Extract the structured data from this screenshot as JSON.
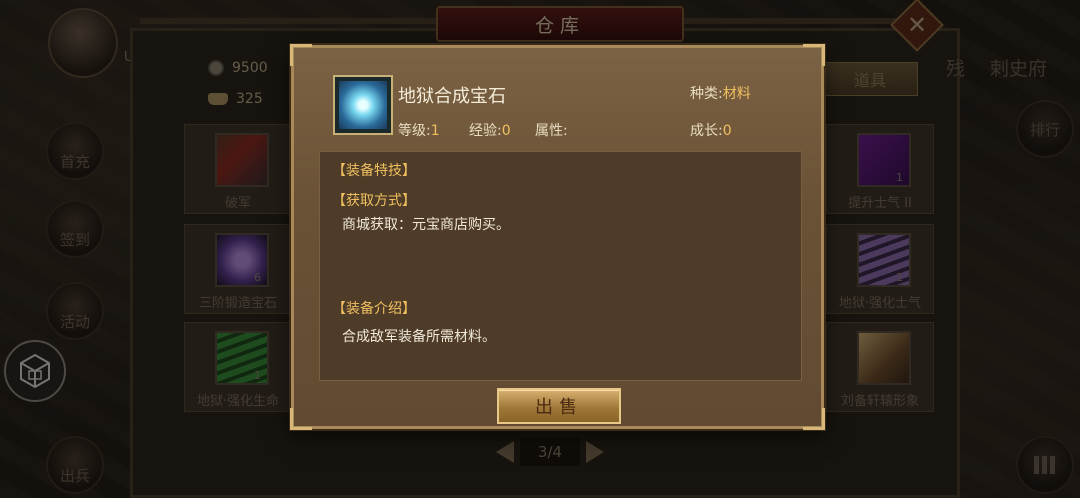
{
  "warehouse": {
    "title": "仓库",
    "uid_label": "UID",
    "silver": "9500",
    "ingot": "325",
    "tab_label": "道具",
    "top_right": [
      "残",
      "剌史府"
    ],
    "left_rail": [
      "首充",
      "签到",
      "活动",
      "出兵"
    ],
    "right_rail": [
      "排行"
    ],
    "slots_left": [
      {
        "label": "破军",
        "count": ""
      },
      {
        "label": "三阶锻造宝石",
        "count": "6"
      },
      {
        "label": "地狱·强化生命",
        "count": "1"
      }
    ],
    "slots_right": [
      {
        "label": "提升士气 II",
        "count": "1"
      },
      {
        "label": "地狱·强化士气",
        "count": "1"
      },
      {
        "label": "刘备轩辕形象",
        "count": ""
      }
    ],
    "pager": "3/4"
  },
  "item": {
    "name": "地狱合成宝石",
    "type_label": "种类:",
    "type_value": "材料",
    "level_label": "等级:",
    "level_value": "1",
    "exp_label": "经验:",
    "exp_value": "0",
    "attr_label": "属性:",
    "growth_label": "成长:",
    "growth_value": "0"
  },
  "description": {
    "skill_title": "【装备特技】",
    "source_title": "【获取方式】",
    "source_text": "商城获取：元宝商店购买。",
    "intro_title": "【装备介绍】",
    "intro_text": "合成敌军装备所需材料。"
  },
  "sell_button": "出售"
}
